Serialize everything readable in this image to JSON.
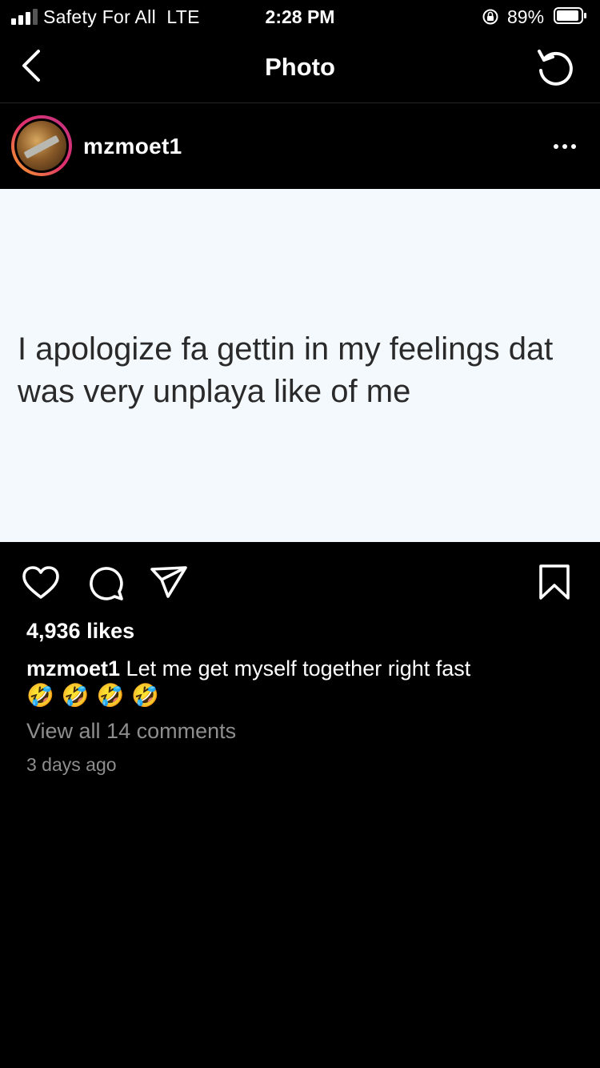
{
  "status_bar": {
    "carrier": "Safety For All  LTE",
    "time": "2:28 PM",
    "battery_percent": "89%",
    "signal_bars": 3,
    "battery_level": 0.89
  },
  "nav": {
    "title": "Photo",
    "back_icon": "chevron-left-icon",
    "refresh_icon": "refresh-icon"
  },
  "post": {
    "username": "mzmoet1",
    "image_text": "I apologize fa gettin in my feelings dat was very unplaya like of me",
    "likes": "4,936 likes",
    "caption_user": "mzmoet1",
    "caption_text": "Let me get myself together right fast",
    "caption_emojis": "🤣 🤣 🤣 🤣",
    "view_comments": "View all 14 comments",
    "time_ago": "3 days ago"
  },
  "colors": {
    "background": "#000000",
    "image_background": "#f3f9fd",
    "secondary_text": "#8e8e8e"
  }
}
